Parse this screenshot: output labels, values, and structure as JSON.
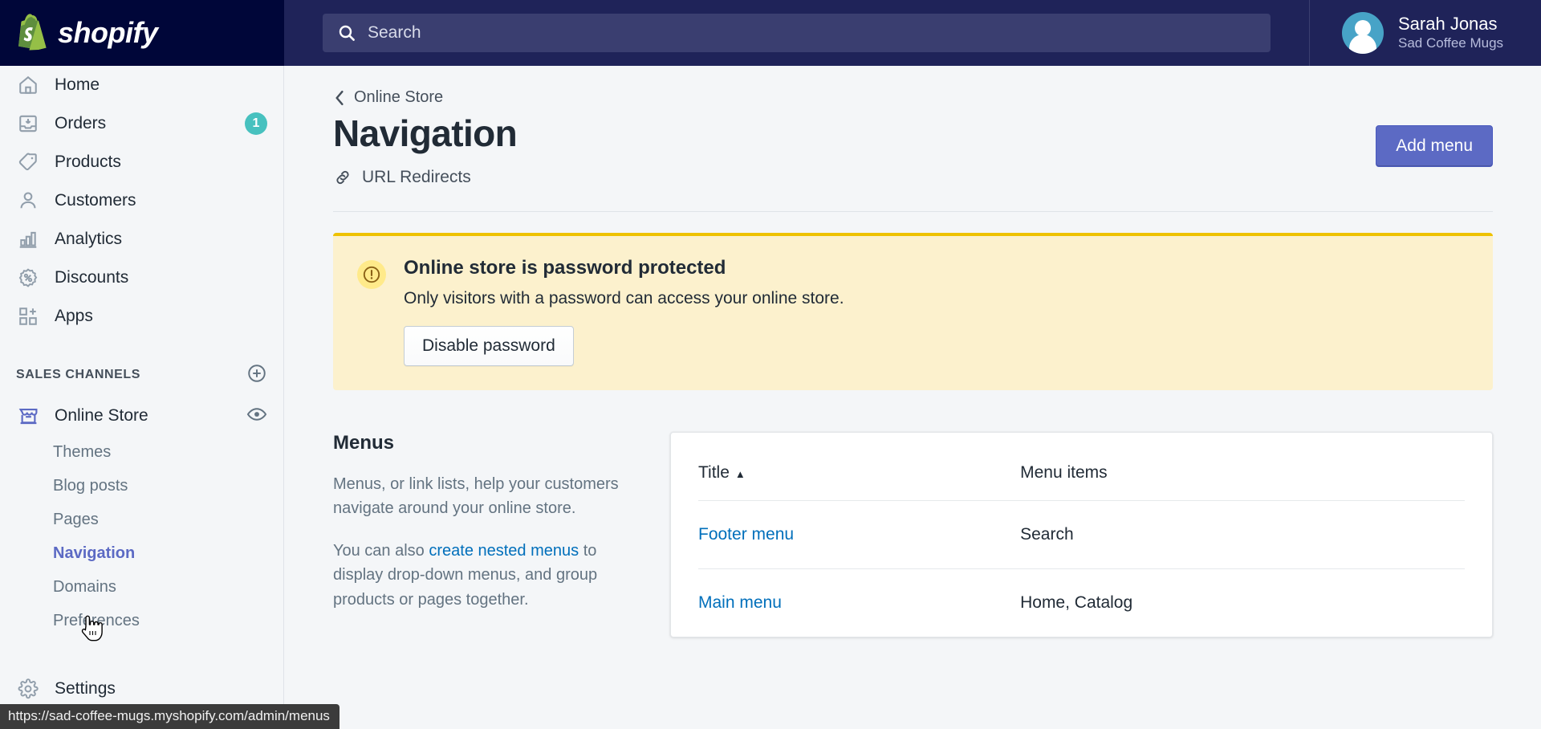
{
  "topbar": {
    "logo_text": "shopify",
    "logo_icon": "shopify-bag-icon",
    "search": {
      "icon": "search-icon",
      "placeholder": "Search",
      "value": ""
    },
    "user": {
      "name": "Sarah Jonas",
      "shop": "Sad Coffee Mugs",
      "avatar_icon": "avatar-person-icon"
    }
  },
  "sidebar": {
    "items": [
      {
        "label": "Home",
        "icon": "home-icon",
        "badge": ""
      },
      {
        "label": "Orders",
        "icon": "orders-inbox-icon",
        "badge": "1"
      },
      {
        "label": "Products",
        "icon": "products-tag-icon",
        "badge": ""
      },
      {
        "label": "Customers",
        "icon": "customers-person-icon",
        "badge": ""
      },
      {
        "label": "Analytics",
        "icon": "analytics-bars-icon",
        "badge": ""
      },
      {
        "label": "Discounts",
        "icon": "discounts-percent-icon",
        "badge": ""
      },
      {
        "label": "Apps",
        "icon": "apps-grid-plus-icon",
        "badge": ""
      }
    ],
    "sales_channels": {
      "title": "SALES CHANNELS",
      "add_icon": "plus-circle-icon",
      "store": {
        "label": "Online Store",
        "icon": "storefront-icon",
        "view_icon": "eye-icon"
      },
      "sub_items": [
        {
          "label": "Themes",
          "active": false
        },
        {
          "label": "Blog posts",
          "active": false
        },
        {
          "label": "Pages",
          "active": false
        },
        {
          "label": "Navigation",
          "active": true
        },
        {
          "label": "Domains",
          "active": false
        },
        {
          "label": "Preferences",
          "active": false
        }
      ]
    },
    "settings": {
      "label": "Settings",
      "icon": "gear-icon"
    }
  },
  "main": {
    "breadcrumb": {
      "label": "Online Store",
      "icon": "chevron-left-icon"
    },
    "page_title": "Navigation",
    "sub_link": {
      "label": "URL Redirects",
      "icon": "link-chain-icon"
    },
    "add_menu_button": "Add menu",
    "banner": {
      "icon": "alert-circle-icon",
      "title": "Online store is password protected",
      "body": "Only visitors with a password can access your online store.",
      "button": "Disable password"
    },
    "menus_section": {
      "title": "Menus",
      "paragraph1": "Menus, or link lists, help your customers navigate around your online store.",
      "paragraph2_pre": "You can also ",
      "paragraph2_link": "create nested menus",
      "paragraph2_post": " to display drop-down menus, and group products or pages together."
    },
    "table": {
      "columns": [
        {
          "label": "Title",
          "sorted": true,
          "sort_caret": "▲"
        },
        {
          "label": "Menu items",
          "sorted": false
        }
      ],
      "rows": [
        {
          "title": "Footer menu",
          "items": "Search"
        },
        {
          "title": "Main menu",
          "items": "Home, Catalog"
        }
      ]
    }
  },
  "statusbar": {
    "url": "https://sad-coffee-mugs.myshopify.com/admin/menus"
  },
  "colors": {
    "brand_navy": "#000639",
    "topbar": "#1F2359",
    "accent_purple": "#5C6AC4",
    "link_blue": "#006FBB",
    "badge_teal": "#47C1BF",
    "banner_bg": "#FCF1CD",
    "banner_border": "#EEC200",
    "page_bg": "#F4F6F8"
  }
}
